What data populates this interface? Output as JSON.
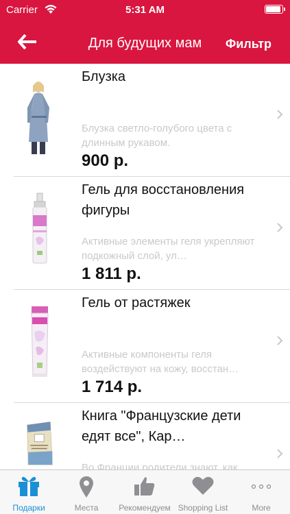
{
  "status_bar": {
    "carrier": "Carrier",
    "time": "5:31 AM"
  },
  "nav": {
    "back_icon": "back-arrow-icon",
    "title": "Для будущих мам",
    "filter_label": "Фильтр"
  },
  "colors": {
    "header": "#d8163f",
    "tab_active": "#1a8fd6",
    "tab_inactive": "#8e8e93",
    "desc_text": "#c9c9c9"
  },
  "products": [
    {
      "name": "Блузка",
      "description": "Блузка светло-голубого цвета с длинным рукавом.",
      "price": "900 р."
    },
    {
      "name": "Гель для восстановления фигуры",
      "description": "Активные элементы геля укрепляют подкожный слой, ул…",
      "price": "1 811 р."
    },
    {
      "name": "Гель от растяжек",
      "description": "Активные компоненты геля воздействуют на кожу, восстан…",
      "price": "1 714 р."
    },
    {
      "name": "Книга \"Французские дети едят все\", Кар…",
      "description": "Во Франции родители знают, как…",
      "price": ""
    }
  ],
  "tabs": [
    {
      "label": "Подарки",
      "icon": "gift-icon",
      "active": true
    },
    {
      "label": "Места",
      "icon": "location-pin-icon",
      "active": false
    },
    {
      "label": "Рекомендуем",
      "icon": "thumbs-up-icon",
      "active": false
    },
    {
      "label": "Shopping List",
      "icon": "heart-icon",
      "active": false
    },
    {
      "label": "More",
      "icon": "more-dots-icon",
      "active": false
    }
  ]
}
